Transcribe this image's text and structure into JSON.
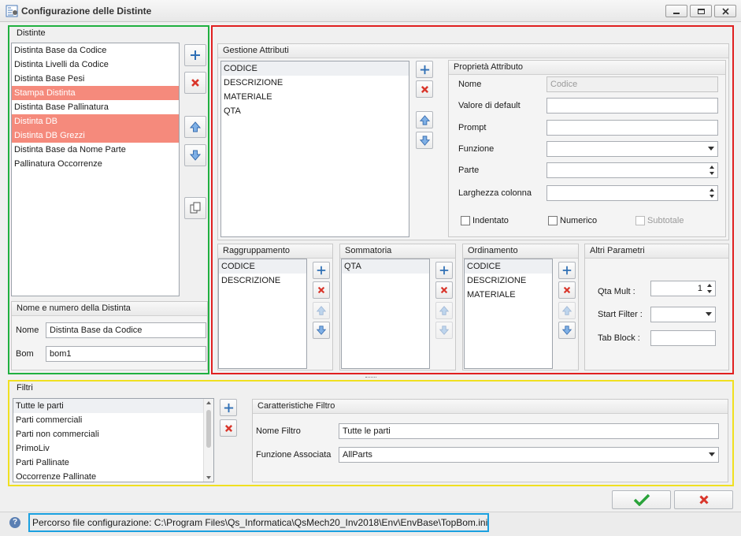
{
  "window": {
    "title": "Configurazione delle Distinte"
  },
  "distinte": {
    "header": "Distinte",
    "items": [
      {
        "label": "Distinta Base da Codice",
        "selected": false
      },
      {
        "label": "Distinta Livelli da Codice",
        "selected": false
      },
      {
        "label": "Distinta Base Pesi",
        "selected": false
      },
      {
        "label": "Stampa Distinta",
        "selected": true
      },
      {
        "label": "Distinta Base Pallinatura",
        "selected": false
      },
      {
        "label": "Distinta DB",
        "selected": true
      },
      {
        "label": "Distinta DB Grezzi",
        "selected": true
      },
      {
        "label": "Distinta Base da Nome Parte",
        "selected": false
      },
      {
        "label": "Pallinatura Occorrenze",
        "selected": false
      }
    ]
  },
  "nome_numero": {
    "header": "Nome e numero della Distinta",
    "nome_label": "Nome",
    "nome_value": "Distinta Base da Codice",
    "bom_label": "Bom",
    "bom_value": "bom1"
  },
  "gestione": {
    "header": "Gestione Attributi",
    "attributi": [
      "CODICE",
      "DESCRIZIONE",
      "MATERIALE",
      "QTA"
    ]
  },
  "proprieta": {
    "header": "Proprietà Attributo",
    "nome_label": "Nome",
    "nome_value": "Codice",
    "default_label": "Valore di default",
    "default_value": "",
    "prompt_label": "Prompt",
    "prompt_value": "",
    "funzione_label": "Funzione",
    "funzione_value": "",
    "parte_label": "Parte",
    "parte_value": "",
    "larghezza_label": "Larghezza colonna",
    "larghezza_value": "",
    "indentato_label": "Indentato",
    "numerico_label": "Numerico",
    "subtotale_label": "Subtotale"
  },
  "raggruppamento": {
    "header": "Raggruppamento",
    "items": [
      "CODICE",
      "DESCRIZIONE"
    ]
  },
  "sommatoria": {
    "header": "Sommatoria",
    "items": [
      "QTA"
    ]
  },
  "ordinamento": {
    "header": "Ordinamento",
    "items": [
      "CODICE",
      "DESCRIZIONE",
      "MATERIALE"
    ]
  },
  "altri": {
    "header": "Altri Parametri",
    "qta_mult_label": "Qta Mult :",
    "qta_mult_value": "1",
    "start_filter_label": "Start Filter :",
    "start_filter_value": "",
    "tab_block_label": "Tab Block :",
    "tab_block_value": ""
  },
  "filtri": {
    "header": "Filtri",
    "items": [
      "Tutte le parti",
      "Parti commerciali",
      "Parti non commerciali",
      "PrimoLiv",
      "Parti Pallinate",
      "Occorrenze Pallinate"
    ]
  },
  "caratteristiche": {
    "header": "Caratteristiche Filtro",
    "nome_label": "Nome Filtro",
    "nome_value": "Tutte le parti",
    "funzione_label": "Funzione Associata",
    "funzione_value": "AllParts"
  },
  "status": {
    "path": "Percorso file configurazione: C:\\Program Files\\Qs_Informatica\\QsMech20_Inv2018\\Env\\EnvBase\\TopBom.ini"
  },
  "colors": {
    "selection": "#f58a7c",
    "frame_green": "#20b040",
    "frame_red": "#e02020",
    "frame_yellow": "#f0e020",
    "frame_blue": "#1aa0e0"
  }
}
